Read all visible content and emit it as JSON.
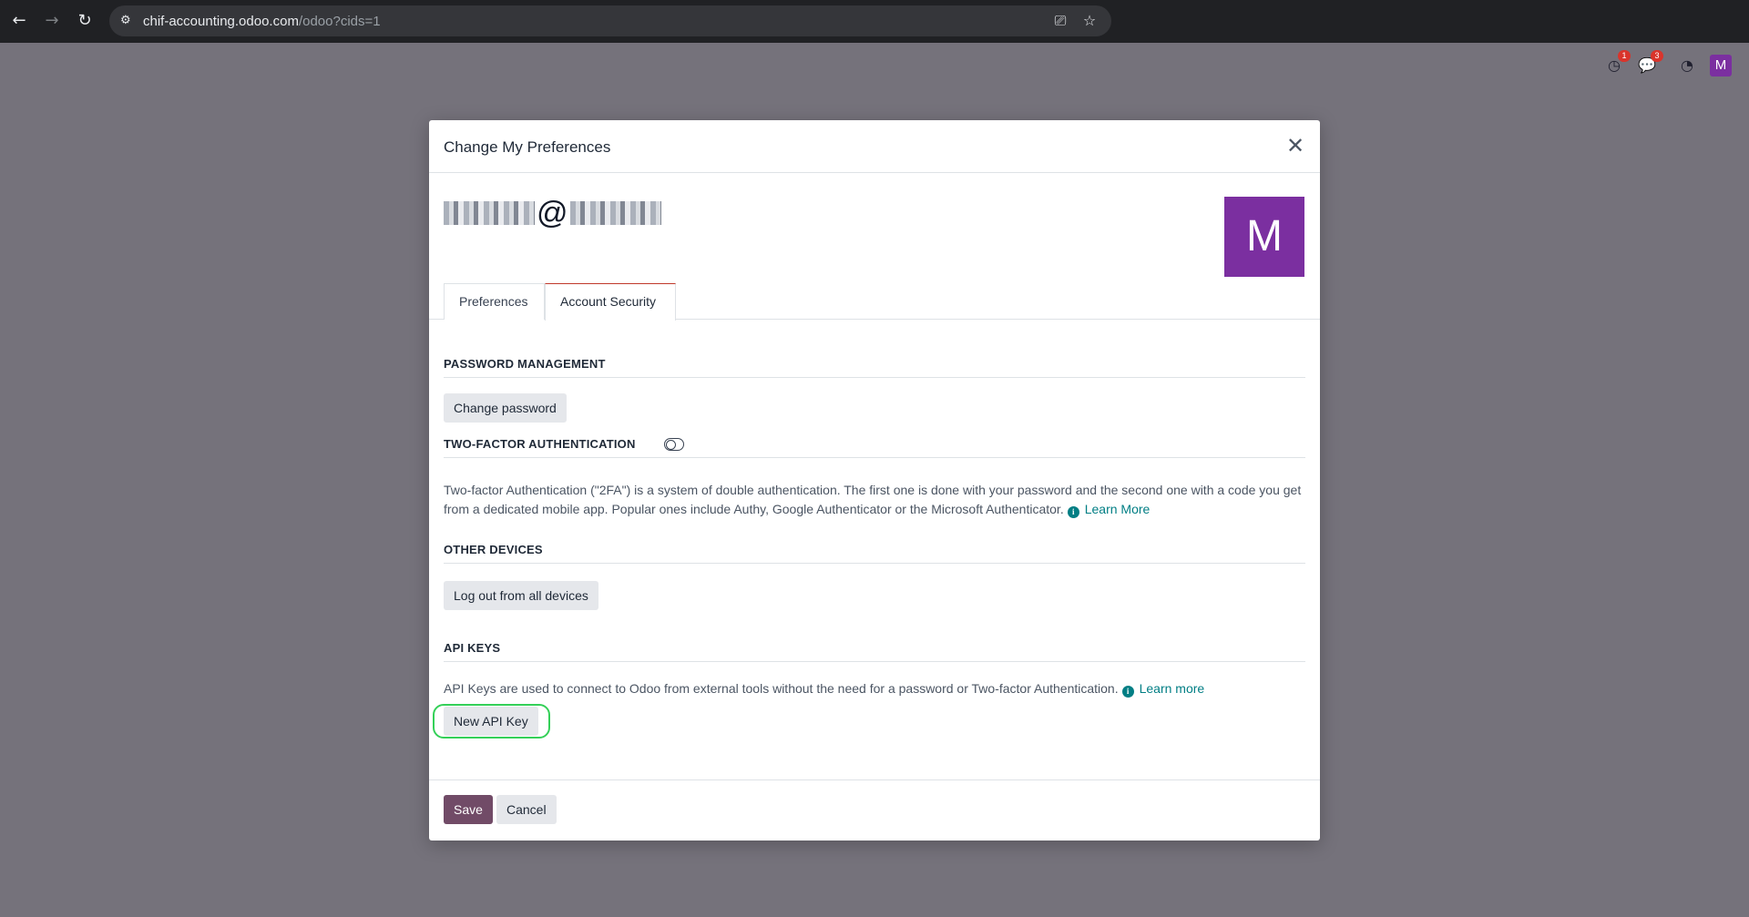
{
  "browser": {
    "url_host": "chif-accounting.odoo.com",
    "url_path": "/odoo?cids=1"
  },
  "systray": {
    "activity_badge": "1",
    "messages_badge": "3",
    "avatar_letter": "M"
  },
  "modal": {
    "title": "Change My Preferences",
    "email_at": "@",
    "avatar_letter": "M",
    "tabs": [
      {
        "label": "Preferences",
        "active": false
      },
      {
        "label": "Account Security",
        "active": true
      }
    ]
  },
  "sections": {
    "password": {
      "title": "PASSWORD MANAGEMENT",
      "button": "Change password"
    },
    "twofa": {
      "title": "TWO-FACTOR AUTHENTICATION",
      "description": "Two-factor Authentication (\"2FA\") is a system of double authentication. The first one is done with your password and the second one with a code you get from a dedicated mobile app. Popular ones include Authy, Google Authenticator or the Microsoft Authenticator.",
      "link": "Learn More"
    },
    "devices": {
      "title": "OTHER DEVICES",
      "button": "Log out from all devices"
    },
    "api_keys": {
      "title": "API KEYS",
      "description": "API Keys are used to connect to Odoo from external tools without the need for a password or Two-factor Authentication.",
      "link": "Learn more",
      "button": "New API Key"
    }
  },
  "footer": {
    "save": "Save",
    "cancel": "Cancel"
  },
  "colors": {
    "brand": "#714b67",
    "link": "#017e84",
    "avatar": "#7b2fa0",
    "highlight": "#34d058"
  }
}
